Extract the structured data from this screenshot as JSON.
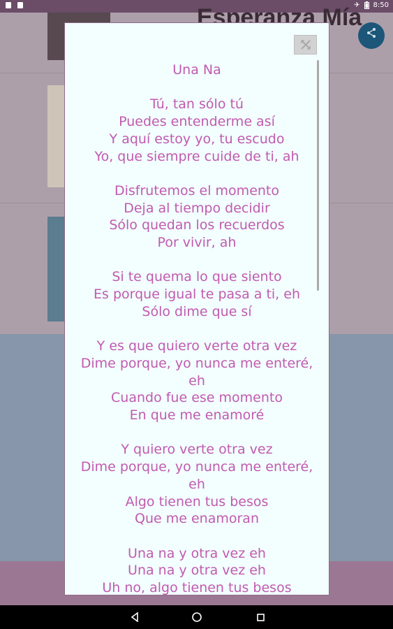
{
  "status_bar": {
    "time": "8:50",
    "icons": [
      "notification-icon",
      "notification-icon",
      "airplane-icon",
      "battery-icon"
    ]
  },
  "background": {
    "title": "Esperanza Mía",
    "share_icon": "share-icon"
  },
  "dialog": {
    "close_icon": "close-icon",
    "title": "Una Na",
    "stanzas": [
      [
        "Tú, tan sólo tú",
        "Puedes entenderme así",
        "Y aquí estoy yo, tu escudo",
        "Yo, que siempre cuide de ti, ah"
      ],
      [
        "Disfrutemos el momento",
        "Deja al tiempo decidir",
        "Sólo quedan los recuerdos",
        "Por vivir, ah"
      ],
      [
        "Si te quema lo que siento",
        "Es porque igual te pasa a ti, eh",
        "Sólo dime que sí"
      ],
      [
        "Y es que quiero verte otra vez",
        "Dime porque, yo nunca me enteré,",
        "eh",
        "Cuando fue ese momento",
        "En que me enamoré"
      ],
      [
        "Y quiero verte otra vez",
        "Dime porque, yo nunca me enteré,",
        "eh",
        "Algo tienen tus besos",
        "Que me enamoran"
      ],
      [
        "Una na y otra vez eh",
        "Una na y otra vez eh",
        "Uh no, algo tienen tus besos"
      ]
    ]
  },
  "nav_bar": {
    "back_icon": "back-icon",
    "home_icon": "home-icon",
    "recents_icon": "recents-icon"
  },
  "colors": {
    "lyrics_text": "#c25aaf",
    "dialog_bg": "#f2fffe",
    "status_bar": "#6b4d68"
  }
}
